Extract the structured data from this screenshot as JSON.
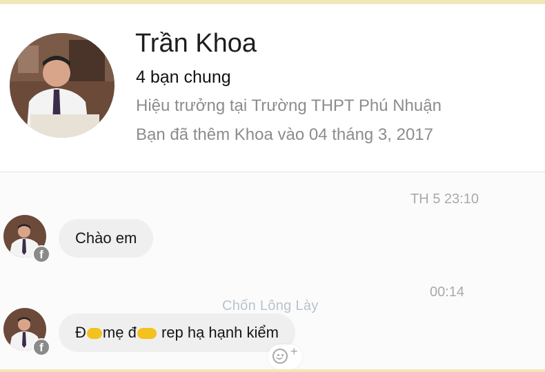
{
  "profile": {
    "name": "Trần Khoa",
    "mutual_friends": "4 bạn chung",
    "job": "Hiệu trưởng tại Trường THPT Phú Nhuận",
    "friend_since": "Bạn đã thêm Khoa vào 04 tháng 3, 2017"
  },
  "chat": {
    "timestamps": [
      "TH 5 23:10",
      "00:14"
    ],
    "messages": [
      {
        "parts": [
          "Chào em"
        ]
      },
      {
        "parts": [
          "Đ",
          "mẹ đ",
          "rep hạ hạnh kiểm"
        ],
        "redactions": 2
      }
    ],
    "badge_icon": "facebook-icon",
    "badge_letter": "f"
  },
  "watermark": "Chốn Lông Lày",
  "colors": {
    "redaction": "#f4c21f",
    "bubble": "#efefef",
    "secondary_text": "#8c8c8c"
  }
}
